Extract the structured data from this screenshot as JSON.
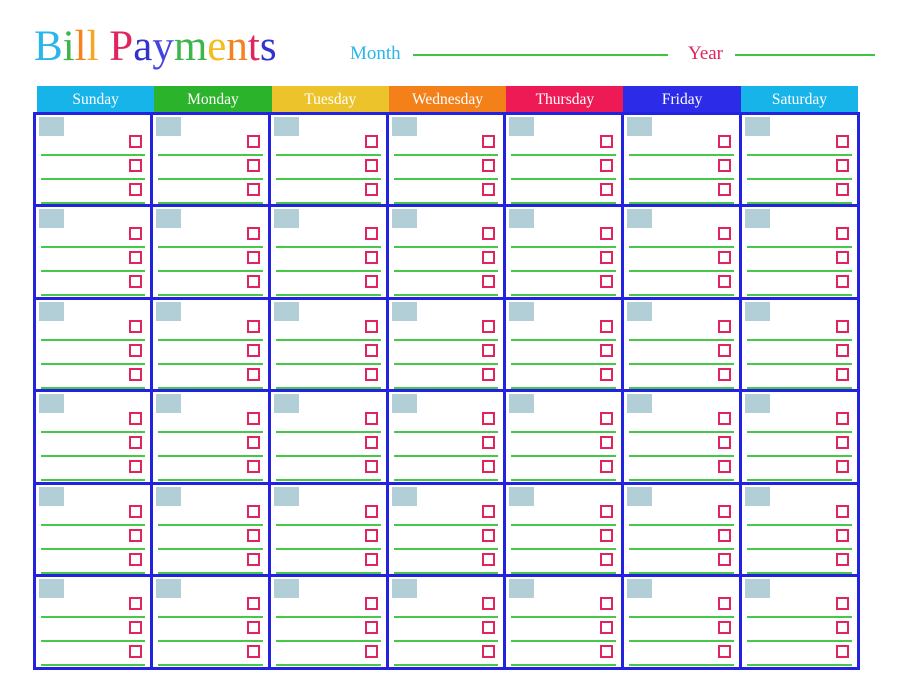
{
  "document": {
    "title_text": "Bill Payments",
    "title_letters": [
      {
        "char": "B",
        "color": "#29b6e8"
      },
      {
        "char": "i",
        "color": "#3cb54a"
      },
      {
        "char": "l",
        "color": "#f5821f"
      },
      {
        "char": "l",
        "color": "#f5a623"
      },
      {
        "char": " ",
        "color": "#000000"
      },
      {
        "char": "P",
        "color": "#e0245e"
      },
      {
        "char": "a",
        "color": "#3333cc"
      },
      {
        "char": "y",
        "color": "#4444dd"
      },
      {
        "char": "m",
        "color": "#3cb54a"
      },
      {
        "char": "e",
        "color": "#f5bc1f"
      },
      {
        "char": "n",
        "color": "#f5821f"
      },
      {
        "char": "t",
        "color": "#e0245e"
      },
      {
        "char": "s",
        "color": "#3333cc"
      }
    ]
  },
  "fields": {
    "month": {
      "label": "Month",
      "label_color": "#29b6e8",
      "value": "",
      "placeholder": "",
      "rule_color": "#3fc43f"
    },
    "year": {
      "label": "Year",
      "label_color": "#e0245e",
      "value": "",
      "placeholder": "",
      "rule_color": "#3fc43f"
    }
  },
  "calendar": {
    "weekday_headers": [
      {
        "label": "Sunday",
        "bg": "#17b4e9"
      },
      {
        "label": "Monday",
        "bg": "#2bb32b"
      },
      {
        "label": "Tuesday",
        "bg": "#edc32c"
      },
      {
        "label": "Wednesday",
        "bg": "#f4801a"
      },
      {
        "label": "Thursday",
        "bg": "#ed1a55"
      },
      {
        "label": "Friday",
        "bg": "#2b2be8"
      },
      {
        "label": "Saturday",
        "bg": "#17b4e9"
      }
    ],
    "rows": 6,
    "columns": 7,
    "entries_per_cell": 3,
    "cell_border_color": "#2222e0",
    "date_box_color": "#b2cfd8",
    "entry_line_color": "#48c848",
    "checkbox_border_color": "#e0245e",
    "cells": [
      {
        "date": "",
        "entries": [
          {
            "text": "",
            "checked": false
          },
          {
            "text": "",
            "checked": false
          },
          {
            "text": "",
            "checked": false
          }
        ]
      },
      {
        "date": "",
        "entries": [
          {
            "text": "",
            "checked": false
          },
          {
            "text": "",
            "checked": false
          },
          {
            "text": "",
            "checked": false
          }
        ]
      },
      {
        "date": "",
        "entries": [
          {
            "text": "",
            "checked": false
          },
          {
            "text": "",
            "checked": false
          },
          {
            "text": "",
            "checked": false
          }
        ]
      },
      {
        "date": "",
        "entries": [
          {
            "text": "",
            "checked": false
          },
          {
            "text": "",
            "checked": false
          },
          {
            "text": "",
            "checked": false
          }
        ]
      },
      {
        "date": "",
        "entries": [
          {
            "text": "",
            "checked": false
          },
          {
            "text": "",
            "checked": false
          },
          {
            "text": "",
            "checked": false
          }
        ]
      },
      {
        "date": "",
        "entries": [
          {
            "text": "",
            "checked": false
          },
          {
            "text": "",
            "checked": false
          },
          {
            "text": "",
            "checked": false
          }
        ]
      },
      {
        "date": "",
        "entries": [
          {
            "text": "",
            "checked": false
          },
          {
            "text": "",
            "checked": false
          },
          {
            "text": "",
            "checked": false
          }
        ]
      },
      {
        "date": "",
        "entries": [
          {
            "text": "",
            "checked": false
          },
          {
            "text": "",
            "checked": false
          },
          {
            "text": "",
            "checked": false
          }
        ]
      },
      {
        "date": "",
        "entries": [
          {
            "text": "",
            "checked": false
          },
          {
            "text": "",
            "checked": false
          },
          {
            "text": "",
            "checked": false
          }
        ]
      },
      {
        "date": "",
        "entries": [
          {
            "text": "",
            "checked": false
          },
          {
            "text": "",
            "checked": false
          },
          {
            "text": "",
            "checked": false
          }
        ]
      },
      {
        "date": "",
        "entries": [
          {
            "text": "",
            "checked": false
          },
          {
            "text": "",
            "checked": false
          },
          {
            "text": "",
            "checked": false
          }
        ]
      },
      {
        "date": "",
        "entries": [
          {
            "text": "",
            "checked": false
          },
          {
            "text": "",
            "checked": false
          },
          {
            "text": "",
            "checked": false
          }
        ]
      },
      {
        "date": "",
        "entries": [
          {
            "text": "",
            "checked": false
          },
          {
            "text": "",
            "checked": false
          },
          {
            "text": "",
            "checked": false
          }
        ]
      },
      {
        "date": "",
        "entries": [
          {
            "text": "",
            "checked": false
          },
          {
            "text": "",
            "checked": false
          },
          {
            "text": "",
            "checked": false
          }
        ]
      },
      {
        "date": "",
        "entries": [
          {
            "text": "",
            "checked": false
          },
          {
            "text": "",
            "checked": false
          },
          {
            "text": "",
            "checked": false
          }
        ]
      },
      {
        "date": "",
        "entries": [
          {
            "text": "",
            "checked": false
          },
          {
            "text": "",
            "checked": false
          },
          {
            "text": "",
            "checked": false
          }
        ]
      },
      {
        "date": "",
        "entries": [
          {
            "text": "",
            "checked": false
          },
          {
            "text": "",
            "checked": false
          },
          {
            "text": "",
            "checked": false
          }
        ]
      },
      {
        "date": "",
        "entries": [
          {
            "text": "",
            "checked": false
          },
          {
            "text": "",
            "checked": false
          },
          {
            "text": "",
            "checked": false
          }
        ]
      },
      {
        "date": "",
        "entries": [
          {
            "text": "",
            "checked": false
          },
          {
            "text": "",
            "checked": false
          },
          {
            "text": "",
            "checked": false
          }
        ]
      },
      {
        "date": "",
        "entries": [
          {
            "text": "",
            "checked": false
          },
          {
            "text": "",
            "checked": false
          },
          {
            "text": "",
            "checked": false
          }
        ]
      },
      {
        "date": "",
        "entries": [
          {
            "text": "",
            "checked": false
          },
          {
            "text": "",
            "checked": false
          },
          {
            "text": "",
            "checked": false
          }
        ]
      },
      {
        "date": "",
        "entries": [
          {
            "text": "",
            "checked": false
          },
          {
            "text": "",
            "checked": false
          },
          {
            "text": "",
            "checked": false
          }
        ]
      },
      {
        "date": "",
        "entries": [
          {
            "text": "",
            "checked": false
          },
          {
            "text": "",
            "checked": false
          },
          {
            "text": "",
            "checked": false
          }
        ]
      },
      {
        "date": "",
        "entries": [
          {
            "text": "",
            "checked": false
          },
          {
            "text": "",
            "checked": false
          },
          {
            "text": "",
            "checked": false
          }
        ]
      },
      {
        "date": "",
        "entries": [
          {
            "text": "",
            "checked": false
          },
          {
            "text": "",
            "checked": false
          },
          {
            "text": "",
            "checked": false
          }
        ]
      },
      {
        "date": "",
        "entries": [
          {
            "text": "",
            "checked": false
          },
          {
            "text": "",
            "checked": false
          },
          {
            "text": "",
            "checked": false
          }
        ]
      },
      {
        "date": "",
        "entries": [
          {
            "text": "",
            "checked": false
          },
          {
            "text": "",
            "checked": false
          },
          {
            "text": "",
            "checked": false
          }
        ]
      },
      {
        "date": "",
        "entries": [
          {
            "text": "",
            "checked": false
          },
          {
            "text": "",
            "checked": false
          },
          {
            "text": "",
            "checked": false
          }
        ]
      },
      {
        "date": "",
        "entries": [
          {
            "text": "",
            "checked": false
          },
          {
            "text": "",
            "checked": false
          },
          {
            "text": "",
            "checked": false
          }
        ]
      },
      {
        "date": "",
        "entries": [
          {
            "text": "",
            "checked": false
          },
          {
            "text": "",
            "checked": false
          },
          {
            "text": "",
            "checked": false
          }
        ]
      },
      {
        "date": "",
        "entries": [
          {
            "text": "",
            "checked": false
          },
          {
            "text": "",
            "checked": false
          },
          {
            "text": "",
            "checked": false
          }
        ]
      },
      {
        "date": "",
        "entries": [
          {
            "text": "",
            "checked": false
          },
          {
            "text": "",
            "checked": false
          },
          {
            "text": "",
            "checked": false
          }
        ]
      },
      {
        "date": "",
        "entries": [
          {
            "text": "",
            "checked": false
          },
          {
            "text": "",
            "checked": false
          },
          {
            "text": "",
            "checked": false
          }
        ]
      },
      {
        "date": "",
        "entries": [
          {
            "text": "",
            "checked": false
          },
          {
            "text": "",
            "checked": false
          },
          {
            "text": "",
            "checked": false
          }
        ]
      },
      {
        "date": "",
        "entries": [
          {
            "text": "",
            "checked": false
          },
          {
            "text": "",
            "checked": false
          },
          {
            "text": "",
            "checked": false
          }
        ]
      },
      {
        "date": "",
        "entries": [
          {
            "text": "",
            "checked": false
          },
          {
            "text": "",
            "checked": false
          },
          {
            "text": "",
            "checked": false
          }
        ]
      },
      {
        "date": "",
        "entries": [
          {
            "text": "",
            "checked": false
          },
          {
            "text": "",
            "checked": false
          },
          {
            "text": "",
            "checked": false
          }
        ]
      },
      {
        "date": "",
        "entries": [
          {
            "text": "",
            "checked": false
          },
          {
            "text": "",
            "checked": false
          },
          {
            "text": "",
            "checked": false
          }
        ]
      },
      {
        "date": "",
        "entries": [
          {
            "text": "",
            "checked": false
          },
          {
            "text": "",
            "checked": false
          },
          {
            "text": "",
            "checked": false
          }
        ]
      },
      {
        "date": "",
        "entries": [
          {
            "text": "",
            "checked": false
          },
          {
            "text": "",
            "checked": false
          },
          {
            "text": "",
            "checked": false
          }
        ]
      },
      {
        "date": "",
        "entries": [
          {
            "text": "",
            "checked": false
          },
          {
            "text": "",
            "checked": false
          },
          {
            "text": "",
            "checked": false
          }
        ]
      },
      {
        "date": "",
        "entries": [
          {
            "text": "",
            "checked": false
          },
          {
            "text": "",
            "checked": false
          },
          {
            "text": "",
            "checked": false
          }
        ]
      }
    ]
  }
}
